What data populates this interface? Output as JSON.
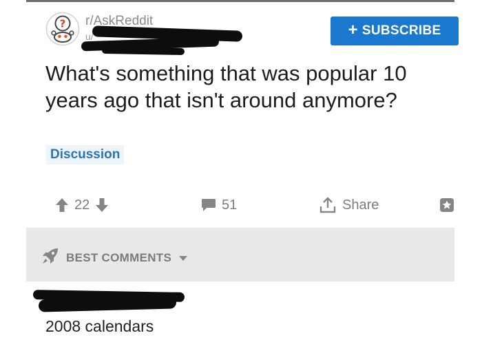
{
  "post": {
    "subreddit": "r/AskReddit",
    "username_partial": "u/",
    "subscribe_label": "SUBSCRIBE",
    "title": "What's something that was popular 10 years ago that isn't around anymore?",
    "flair": "Discussion",
    "upvotes": "22",
    "comments": "51",
    "share_label": "Share"
  },
  "sort": {
    "label": "BEST COMMENTS"
  },
  "comment": {
    "text": "2008 calendars"
  },
  "colors": {
    "subscribe_bg": "#1a78cf",
    "flair_text": "#2b73b8",
    "sort_bar_bg": "#e8e8e8"
  }
}
